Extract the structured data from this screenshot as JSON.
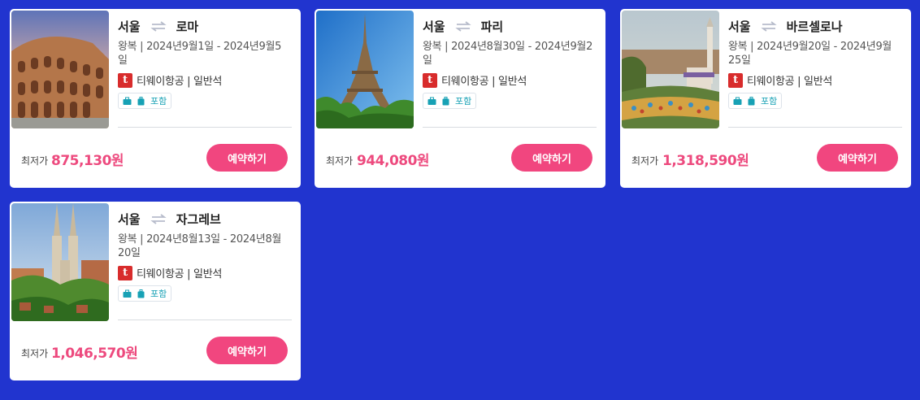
{
  "cards": [
    {
      "origin": "서울",
      "destination": "로마",
      "dates_line1": "왕복 | 2024년9월1일 - 2024년9월5",
      "dates_line2": "일",
      "airline": "티웨이항공 | 일반석",
      "airline_logo_char": "t",
      "included_label": "포함",
      "price_label": "최저가",
      "price": "875,130원",
      "book_label": "예약하기",
      "image": "colosseum"
    },
    {
      "origin": "서울",
      "destination": "파리",
      "dates_line1": "왕복 | 2024년8월30일 - 2024년9월2",
      "dates_line2": "일",
      "airline": "티웨이항공 | 일반석",
      "airline_logo_char": "t",
      "included_label": "포함",
      "price_label": "최저가",
      "price": "944,080원",
      "book_label": "예약하기",
      "image": "eiffel-tower"
    },
    {
      "origin": "서울",
      "destination": "바르셀로나",
      "dates_line1": "왕복 | 2024년9월20일 - 2024년9월",
      "dates_line2": "25일",
      "airline": "티웨이항공 | 일반석",
      "airline_logo_char": "t",
      "included_label": "포함",
      "price_label": "최저가",
      "price": "1,318,590원",
      "book_label": "예약하기",
      "image": "park-guell"
    },
    {
      "origin": "서울",
      "destination": "자그레브",
      "dates_line1": "왕복 | 2024년8월13일 - 2024년8월",
      "dates_line2": "20일",
      "airline": "티웨이항공 | 일반석",
      "airline_logo_char": "t",
      "included_label": "포함",
      "price_label": "최저가",
      "price": "1,046,570원",
      "book_label": "예약하기",
      "image": "zagreb-cathedral"
    }
  ],
  "colors": {
    "background": "#2134cf",
    "price": "#ed4a7e",
    "button": "#f1467f",
    "badge_text": "#17a1b5",
    "airline_logo": "#d82c2c"
  }
}
